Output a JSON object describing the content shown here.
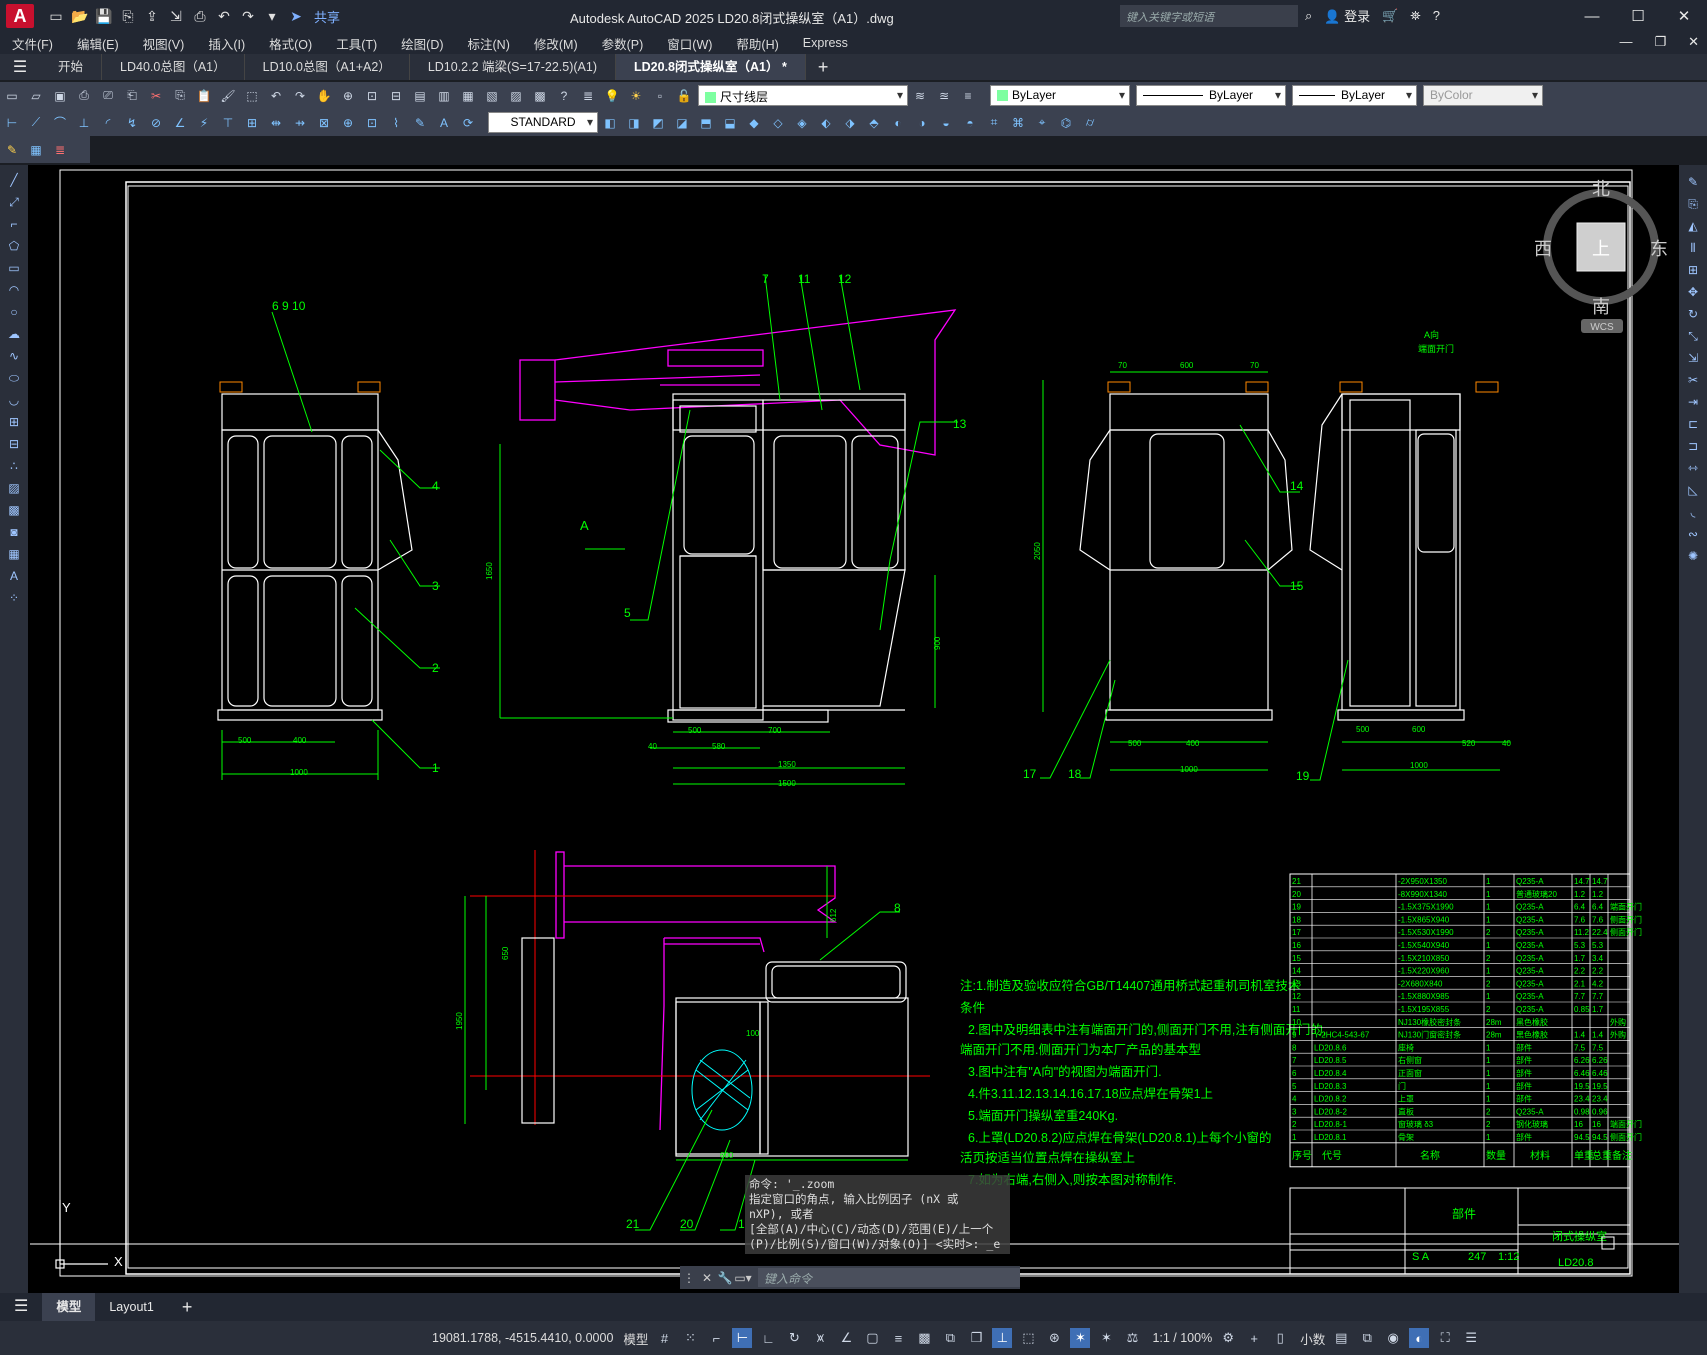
{
  "app": {
    "logo": "A",
    "title": "Autodesk AutoCAD 2025    LD20.8闭式操纵室（A1）.dwg",
    "share": "共享",
    "search_placeholder": "键入关键字或短语",
    "login": "登录"
  },
  "menu": [
    "文件(F)",
    "编辑(E)",
    "视图(V)",
    "插入(I)",
    "格式(O)",
    "工具(T)",
    "绘图(D)",
    "标注(N)",
    "修改(M)",
    "参数(P)",
    "窗口(W)",
    "帮助(H)",
    "Express"
  ],
  "doc_tabs": [
    {
      "label": "开始",
      "active": false
    },
    {
      "label": "LD40.0总图（A1）",
      "active": false
    },
    {
      "label": "LD10.0总图（A1+A2）",
      "active": false
    },
    {
      "label": "LD10.2.2 端梁(S=17-22.5)(A1)",
      "active": false
    },
    {
      "label": "LD20.8闭式操纵室（A1） *",
      "active": true
    }
  ],
  "properties": {
    "layer": "尺寸线层",
    "color": "ByLayer",
    "linetype": "ByLayer",
    "lineweight": "ByLayer",
    "plotstyle": "ByColor",
    "text_style": "STANDARD"
  },
  "viewcube": {
    "north": "北",
    "south": "南",
    "east": "东",
    "west": "西",
    "top": "上",
    "wcs": "WCS"
  },
  "drawing": {
    "balloons_top": [
      "6  9  10",
      "7",
      "11",
      "12",
      "13",
      "4",
      "3",
      "2",
      "1",
      "5",
      "14",
      "15",
      "17",
      "18",
      "19"
    ],
    "balloons_bottom": [
      "8",
      "21",
      "20",
      "1"
    ],
    "view_a_label": "A",
    "view_title_a": "A向",
    "view_title_b": "端面开门",
    "dims_view1": [
      "500",
      "400",
      "1000"
    ],
    "dims_view2": [
      "500",
      "700",
      "580",
      "40",
      "1350",
      "1500",
      "1650",
      "900"
    ],
    "dims_view3": [
      "70",
      "600",
      "70",
      "500",
      "400",
      "1000",
      "2050"
    ],
    "dims_view4": [
      "500",
      "600",
      "520",
      "40",
      "1000"
    ],
    "dims_bottom": [
      "600",
      "612",
      "1950",
      "650",
      "100"
    ],
    "notes": [
      "注:1.制造及验收应符合GB/T14407通用桥式起重机司机室技术",
      "条件",
      "2.图中及明细表中注有端面开门的,侧面开门不用,注有侧面开门的,",
      "端面开门不用.侧面开门为本厂产品的基本型",
      "3.图中注有\"A向\"的视图为端面开门.",
      "4.件3.11.12.13.14.16.17.18应点焊在骨架1上",
      "5.端面开门操纵室重240Kg.",
      "6.上罩(LD20.8.2)应点焊在骨架(LD20.8.1)上每个小窗的",
      "活页按适当位置点焊在操纵室上",
      "7.如为右端,右侧入,则按本图对称制作."
    ],
    "bom_rows": [
      [
        "21",
        "",
        "-2X950X1350",
        "1",
        "Q235-A",
        "14.7",
        "14.7",
        ""
      ],
      [
        "20",
        "",
        "-8X990X1340",
        "1",
        "普通玻璃20",
        "1.2",
        "1.2",
        ""
      ],
      [
        "19",
        "",
        "-1.5X375X1990",
        "1",
        "Q235-A",
        "6.4",
        "6.4",
        "端面开门"
      ],
      [
        "18",
        "",
        "-1.5X865X940",
        "1",
        "Q235-A",
        "7.6",
        "7.6",
        "侧面开门"
      ],
      [
        "17",
        "",
        "-1.5X530X1990",
        "2",
        "Q235-A",
        "11.2",
        "22.4",
        "侧面开门"
      ],
      [
        "16",
        "",
        "-1.5X540X940",
        "1",
        "Q235-A",
        "5.3",
        "5.3",
        ""
      ],
      [
        "15",
        "",
        "-1.5X210X850",
        "2",
        "Q235-A",
        "1.7",
        "3.4",
        ""
      ],
      [
        "14",
        "",
        "-1.5X220X960",
        "1",
        "Q235-A",
        "2.2",
        "2.2",
        ""
      ],
      [
        "13",
        "",
        "-2X680X840",
        "2",
        "Q235-A",
        "2.1",
        "4.2",
        ""
      ],
      [
        "12",
        "",
        "-1.5X880X985",
        "1",
        "Q235-A",
        "7.7",
        "7.7",
        ""
      ],
      [
        "11",
        "",
        "-1.5X195X855",
        "2",
        "Q235-A",
        "0.85",
        "1.7",
        ""
      ],
      [
        "10",
        "",
        "NJ130橡胶密封条",
        "28m",
        "黑色橡胶",
        "",
        "",
        "外购"
      ],
      [
        "9",
        "Y-2HC4-543-67",
        "NJ130门窗密封条",
        "28m",
        "黑色橡胶",
        "1.4",
        "1.4",
        "外购"
      ],
      [
        "8",
        "LD20.8.6",
        "座椅",
        "1",
        "部件",
        "7.5",
        "7.5",
        ""
      ],
      [
        "7",
        "LD20.8.5",
        "右侧窗",
        "1",
        "部件",
        "6.26",
        "6.26",
        ""
      ],
      [
        "6",
        "LD20.8.4",
        "正面窗",
        "1",
        "部件",
        "6.46",
        "6.46",
        ""
      ],
      [
        "5",
        "LD20.8.3",
        "门",
        "1",
        "部件",
        "19.5",
        "19.5",
        ""
      ],
      [
        "4",
        "LD20.8.2",
        "上罩",
        "1",
        "部件",
        "23.4",
        "23.4",
        ""
      ],
      [
        "3",
        "LD20.8-2",
        "直板",
        "2",
        "Q235-A",
        "0.98",
        "0.96",
        ""
      ],
      [
        "2",
        "LD20.8-1",
        "窗玻璃 δ3",
        "2",
        "钢化玻璃",
        "16",
        "16",
        "端面开门"
      ],
      [
        "1",
        "LD20.8.1",
        "骨架",
        "1",
        "部件",
        "94.5",
        "94.5",
        "侧面开门"
      ]
    ],
    "bom_header": [
      "序号",
      "代号",
      "名称",
      "数量",
      "材料",
      "单重",
      "总重",
      "备注"
    ],
    "title_block": {
      "type": "部件",
      "name": "闭式操纵室",
      "code": "LD20.8",
      "mark": "S A",
      "weight": "247",
      "scale": "1:12"
    }
  },
  "command": {
    "history": [
      "命令: '_.zoom",
      "指定窗口的角点, 输入比例因子 (nX 或",
      "nXP), 或者",
      "[全部(A)/中心(C)/动态(D)/范围(E)/上一个",
      "(P)/比例(S)/窗口(W)/对象(O)] <实时>: _e"
    ],
    "placeholder": "键入命令"
  },
  "layout_tabs": [
    "模型",
    "Layout1"
  ],
  "status": {
    "coords": "19081.1788, -4515.4410, 0.0000",
    "space": "模型",
    "annoscale": "1:1 / 100%",
    "units": "小数"
  },
  "colors": {
    "drawing_bg": "#000000",
    "line_white": "#ffffff",
    "line_green": "#00ff00",
    "line_magenta": "#ff00ff",
    "line_red": "#ff0000",
    "line_cyan": "#00ffff"
  }
}
